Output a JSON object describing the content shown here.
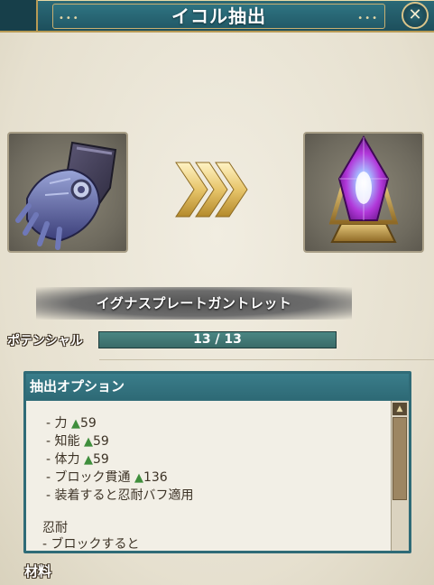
{
  "header": {
    "title": "イコル抽出",
    "left_dots": "•••",
    "right_dots": "•••",
    "close_symbol": "✕"
  },
  "source_item": {
    "icon": "gauntlet-icon"
  },
  "target_item": {
    "icon": "icor-crystal-icon"
  },
  "transfer_icon": "triple-chevron-right-icon",
  "item_name": "イグナスプレートガントレット",
  "potential": {
    "label": "ポテンシャル",
    "current": 13,
    "max": 13,
    "text": "13 / 13",
    "fill_fraction": 1.0
  },
  "options_panel": {
    "title": "抽出オプション",
    "lines": [
      {
        "text": "- 力 ",
        "bonus": "59"
      },
      {
        "text": "- 知能 ",
        "bonus": "59"
      },
      {
        "text": "- 体力 ",
        "bonus": "59"
      },
      {
        "text": "- ブロック貫通 ",
        "bonus": "136"
      },
      {
        "text": "- 装着すると忍耐バフ適用",
        "bonus": ""
      },
      {
        "text": "",
        "bonus": ""
      },
      {
        "text": "忍耐",
        "bonus": ""
      },
      {
        "text": "- ブロックすると",
        "bonus": ""
      }
    ],
    "bonus_marker": "▲",
    "scroll_up_symbol": "▲"
  },
  "materials_label": "材料",
  "colors": {
    "panel_teal": "#2f6b77",
    "bonus_green": "#3f8e3c",
    "title_bar": "#225a67",
    "gold": "#b79a55"
  }
}
